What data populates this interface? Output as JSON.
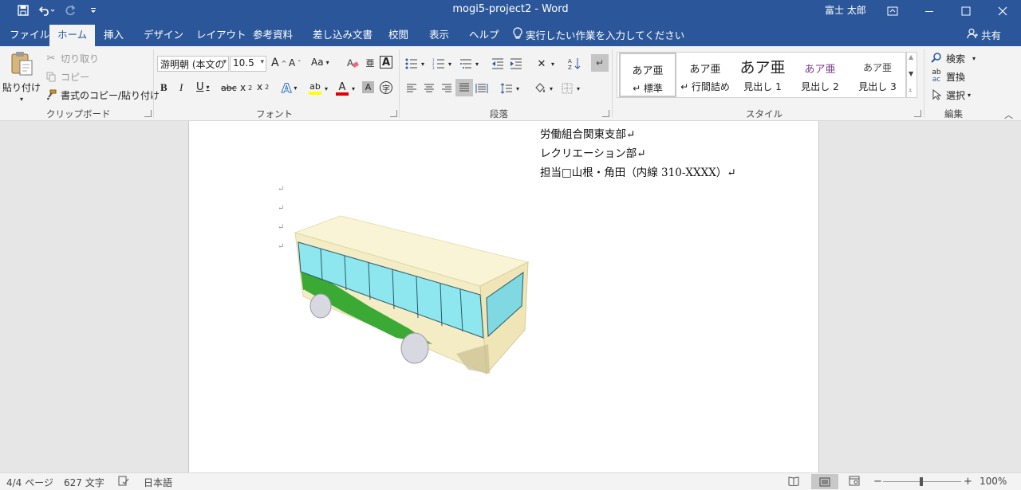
{
  "titlebar": {
    "doc_title": "mogi5-project2  -  Word",
    "user": "富士 太郎",
    "qat": [
      "save-icon",
      "undo-icon",
      "redo-icon",
      "customize-icon"
    ]
  },
  "tabs": [
    "ファイル",
    "ホーム",
    "挿入",
    "デザイン",
    "レイアウト",
    "参考資料",
    "差し込み文書",
    "校閲",
    "表示",
    "ヘルプ"
  ],
  "active_tab": "ホーム",
  "tell_me": "実行したい作業を入力してください",
  "share": "共有",
  "ribbon": {
    "clipboard": {
      "label": "クリップボード",
      "paste": "貼り付け",
      "cut": "切り取り",
      "copy": "コピー",
      "format_painter": "書式のコピー/貼り付け"
    },
    "font": {
      "label": "フォント",
      "font_name": "游明朝 (本文の",
      "font_size": "10.5",
      "aa_label": "Aa"
    },
    "paragraph": {
      "label": "段落"
    },
    "styles": {
      "label": "スタイル",
      "items": [
        {
          "preview": "あア亜",
          "name": "↵ 標準"
        },
        {
          "preview": "あア亜",
          "name": "↵ 行間詰め"
        },
        {
          "preview": "あア亜",
          "name": "見出し 1"
        },
        {
          "preview": "あア亜",
          "name": "見出し 2"
        },
        {
          "preview": "あア亜",
          "name": "見出し 3"
        }
      ]
    },
    "editing": {
      "label": "編集",
      "find": "検索",
      "replace": "置換",
      "select": "選択"
    }
  },
  "document": {
    "lines": [
      "労働組合関東支部↵",
      "レクリエーション部↵",
      "担当□山根・角田（内線 310-XXXX）↵"
    ],
    "para_mark": "↵"
  },
  "status": {
    "page": "4/4 ページ",
    "words": "627 文字",
    "language": "日本語",
    "zoom": "100%"
  },
  "colors": {
    "accent": "#2b579a",
    "bus_body": "#f3ecc4",
    "bus_roof": "#faf4d6",
    "bus_window": "#8ee6ee",
    "bus_stripe": "#3aaa35"
  }
}
